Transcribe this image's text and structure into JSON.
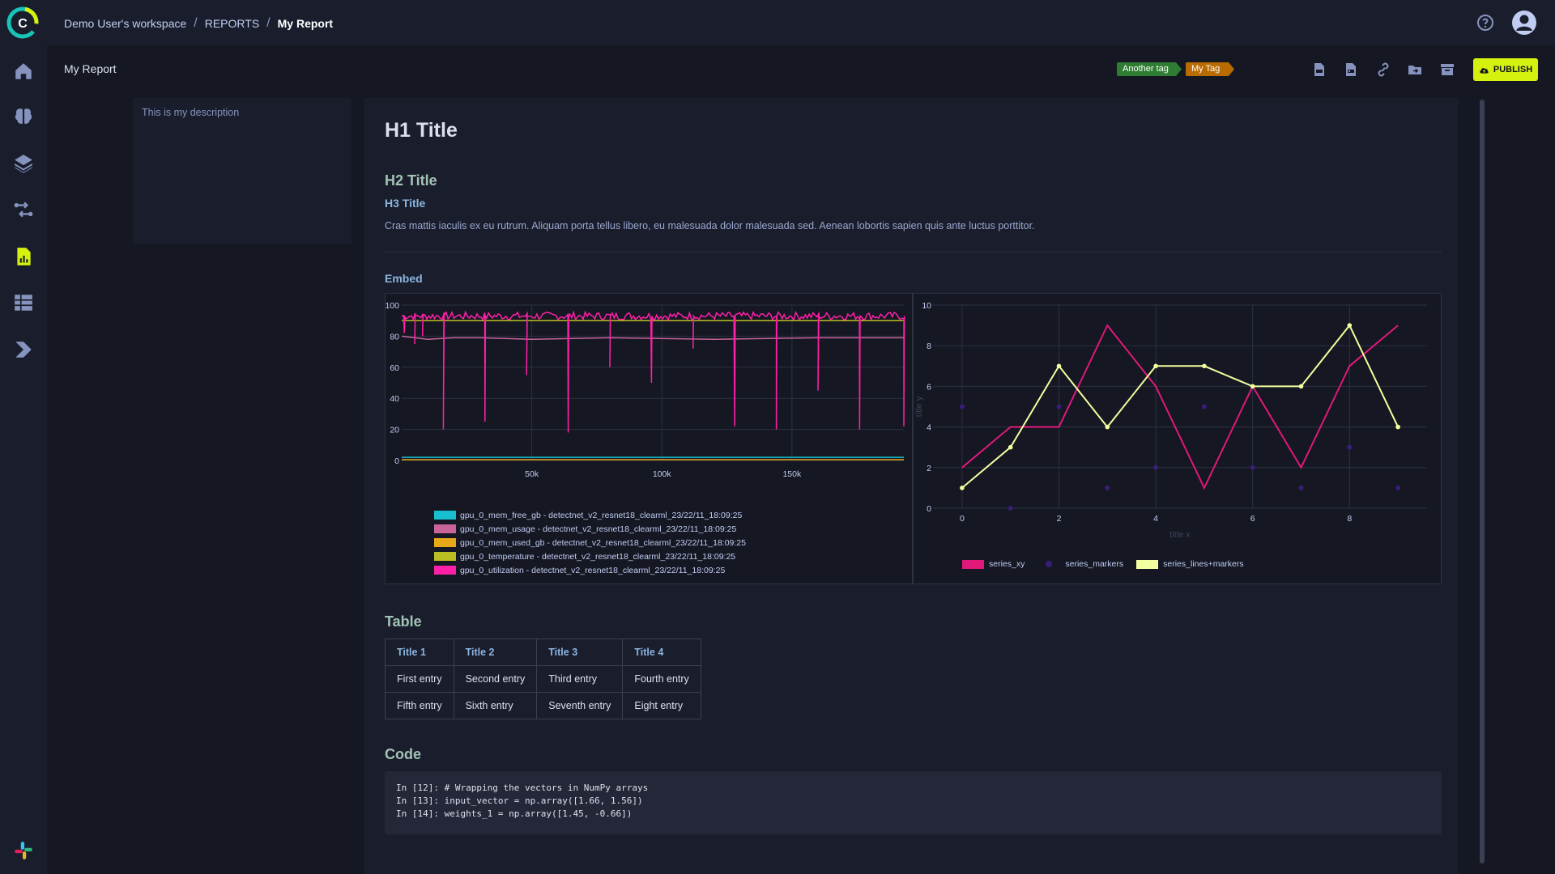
{
  "breadcrumb": {
    "workspace": "Demo User's workspace",
    "section": "REPORTS",
    "current": "My Report"
  },
  "report": {
    "title": "My Report",
    "description": "This is my description",
    "tags": [
      "Another tag",
      "My Tag"
    ],
    "publish_label": "PUBLISH"
  },
  "colors": {
    "accent": "#d4f20d",
    "tag_green": "#2e7d32",
    "tag_orange": "#b96b00",
    "background": "#151722",
    "panel": "#1a1e2c"
  },
  "icons": {
    "rail": [
      "home-icon",
      "brain-icon",
      "layers-icon",
      "pipelines-icon",
      "reports-icon",
      "datasets-icon",
      "deploy-icon",
      "slack-icon"
    ],
    "actions": [
      "export-md-icon",
      "export-pdf-icon",
      "link-icon",
      "move-icon",
      "archive-icon"
    ]
  },
  "content": {
    "h1": "H1 Title",
    "h2": "H2 Title",
    "h3": "H3 Title",
    "paragraph": "Cras mattis iaculis ex eu rutrum. Aliquam porta tellus libero, eu malesuada dolor malesuada sed. Aenean lobortis sapien quis ante luctus porttitor.",
    "embed_title": "Embed",
    "table_title": "Table",
    "code_title": "Code",
    "code": "In [12]: # Wrapping the vectors in NumPy arrays\nIn [13]: input_vector = np.array([1.66, 1.56])\nIn [14]: weights_1 = np.array([1.45, -0.66])"
  },
  "table": {
    "headers": [
      "Title 1",
      "Title 2",
      "Title 3",
      "Title 4"
    ],
    "rows": [
      [
        "First entry",
        "Second entry",
        "Third entry",
        "Fourth entry"
      ],
      [
        "Fifth entry",
        "Sixth entry",
        "Seventh entry",
        "Eight entry"
      ]
    ]
  },
  "chart_data": [
    {
      "type": "line",
      "x_range": [
        0,
        193000
      ],
      "ylim": [
        0,
        100
      ],
      "x_ticks": [
        50000,
        100000,
        150000
      ],
      "x_tick_labels": [
        "50k",
        "100k",
        "150k"
      ],
      "y_ticks": [
        0,
        20,
        40,
        60,
        80,
        100
      ],
      "grid": true,
      "legend_position": "bottom",
      "series": [
        {
          "name": "gpu_0_mem_free_gb - detectnet_v2_resnet18_clearml_23/22/11_18:09:25",
          "color": "#17becf",
          "x": [
            0,
            193000
          ],
          "y": [
            2,
            2
          ]
        },
        {
          "name": "gpu_0_mem_usage - detectnet_v2_resnet18_clearml_23/22/11_18:09:25",
          "color": "#c8649b",
          "x": [
            0,
            10000,
            20000,
            30000,
            50000,
            80000,
            120000,
            160000,
            193000
          ],
          "y": [
            80,
            78,
            79,
            79,
            78,
            79,
            78,
            79,
            79
          ]
        },
        {
          "name": "gpu_0_mem_used_gb - detectnet_v2_resnet18_clearml_23/22/11_18:09:25",
          "color": "#e6a817",
          "x": [
            0,
            193000
          ],
          "y": [
            0.5,
            0.5
          ]
        },
        {
          "name": "gpu_0_temperature - detectnet_v2_resnet18_clearml_23/22/11_18:09:25",
          "color": "#bcbd22",
          "x": [
            0,
            193000
          ],
          "y": [
            90,
            90
          ]
        },
        {
          "name": "gpu_0_utilization - detectnet_v2_resnet18_clearml_23/22/11_18:09:25",
          "color": "#ff1fa8",
          "x": [
            0,
            193000
          ],
          "y": [
            93,
            93
          ],
          "dips": [
            [
              1000,
              82
            ],
            [
              5000,
              75
            ],
            [
              8000,
              80
            ],
            [
              16000,
              20
            ],
            [
              32000,
              25
            ],
            [
              48000,
              55
            ],
            [
              64000,
              18
            ],
            [
              80000,
              60
            ],
            [
              96000,
              50
            ],
            [
              112000,
              72
            ],
            [
              128000,
              22
            ],
            [
              144000,
              20
            ],
            [
              160000,
              45
            ],
            [
              176000,
              20
            ],
            [
              193000,
              22
            ]
          ]
        }
      ]
    },
    {
      "type": "scatter",
      "xlabel": "title x",
      "ylabel": "title y",
      "xlim": [
        -0.6,
        9.6
      ],
      "ylim": [
        0,
        10
      ],
      "x_ticks": [
        0,
        2,
        4,
        6,
        8
      ],
      "y_ticks": [
        0,
        2,
        4,
        6,
        8,
        10
      ],
      "grid": true,
      "legend_position": "bottom",
      "series": [
        {
          "name": "series_xy",
          "mode": "lines",
          "color": "#e0187a",
          "x": [
            0,
            1,
            2,
            3,
            4,
            5,
            6,
            7,
            8,
            9
          ],
          "y": [
            2,
            4,
            4,
            9,
            6,
            1,
            6,
            2,
            7,
            9
          ]
        },
        {
          "name": "series_markers",
          "mode": "markers",
          "color": "#3a1d7a",
          "x": [
            0,
            1,
            2,
            3,
            4,
            5,
            6,
            7,
            8,
            9
          ],
          "y": [
            5,
            0,
            5,
            1,
            2,
            5,
            2,
            1,
            3,
            1
          ]
        },
        {
          "name": "series_lines+markers",
          "mode": "lines+markers",
          "color": "#f4ffa0",
          "x": [
            0,
            1,
            2,
            3,
            4,
            5,
            6,
            7,
            8,
            9
          ],
          "y": [
            1,
            3,
            7,
            4,
            7,
            7,
            6,
            6,
            9,
            4
          ]
        }
      ]
    }
  ]
}
